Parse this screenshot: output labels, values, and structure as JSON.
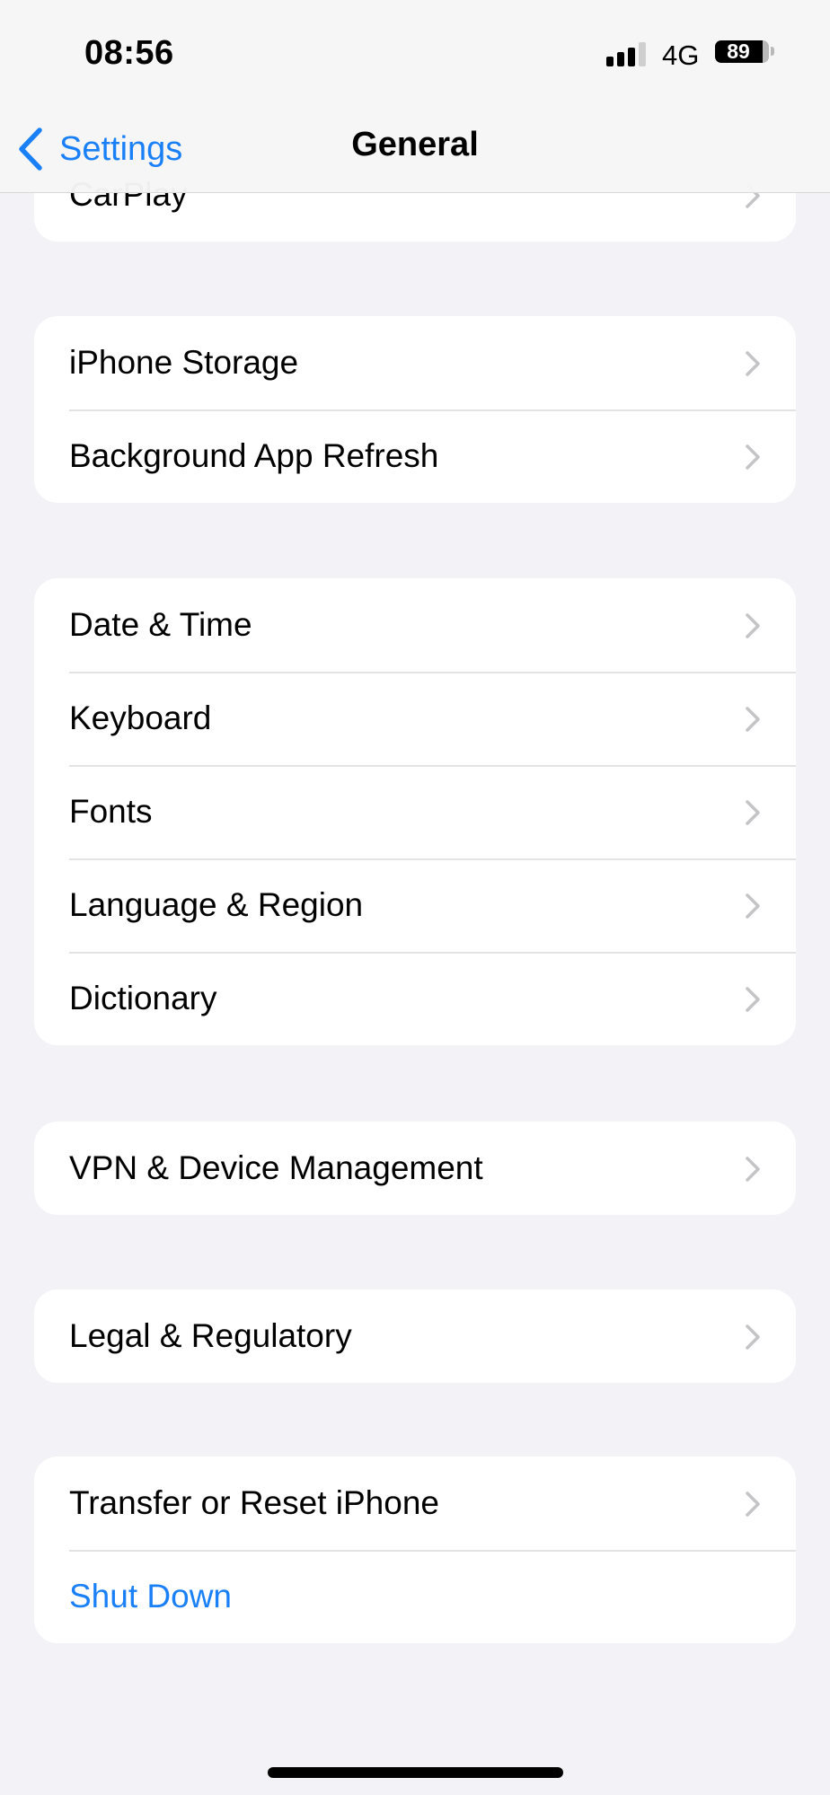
{
  "status_bar": {
    "time": "08:56",
    "network": "4G",
    "battery_percent": "89",
    "battery_level": 0.89,
    "signal_bars_active": 3,
    "signal_bars_total": 4
  },
  "nav": {
    "back_label": "Settings",
    "title": "General"
  },
  "colors": {
    "accent": "#1a80f7",
    "background": "#f2f2f7"
  },
  "groups": [
    {
      "rows": [
        {
          "label": "CarPlay",
          "chevron": true
        }
      ]
    },
    {
      "rows": [
        {
          "label": "iPhone Storage",
          "chevron": true
        },
        {
          "label": "Background App Refresh",
          "chevron": true
        }
      ]
    },
    {
      "rows": [
        {
          "label": "Date & Time",
          "chevron": true
        },
        {
          "label": "Keyboard",
          "chevron": true
        },
        {
          "label": "Fonts",
          "chevron": true
        },
        {
          "label": "Language & Region",
          "chevron": true
        },
        {
          "label": "Dictionary",
          "chevron": true
        }
      ]
    },
    {
      "rows": [
        {
          "label": "VPN & Device Management",
          "chevron": true
        }
      ]
    },
    {
      "rows": [
        {
          "label": "Legal & Regulatory",
          "chevron": true
        }
      ]
    },
    {
      "rows": [
        {
          "label": "Transfer or Reset iPhone",
          "chevron": true
        },
        {
          "label": "Shut Down",
          "chevron": false,
          "style": "accent"
        }
      ]
    }
  ]
}
